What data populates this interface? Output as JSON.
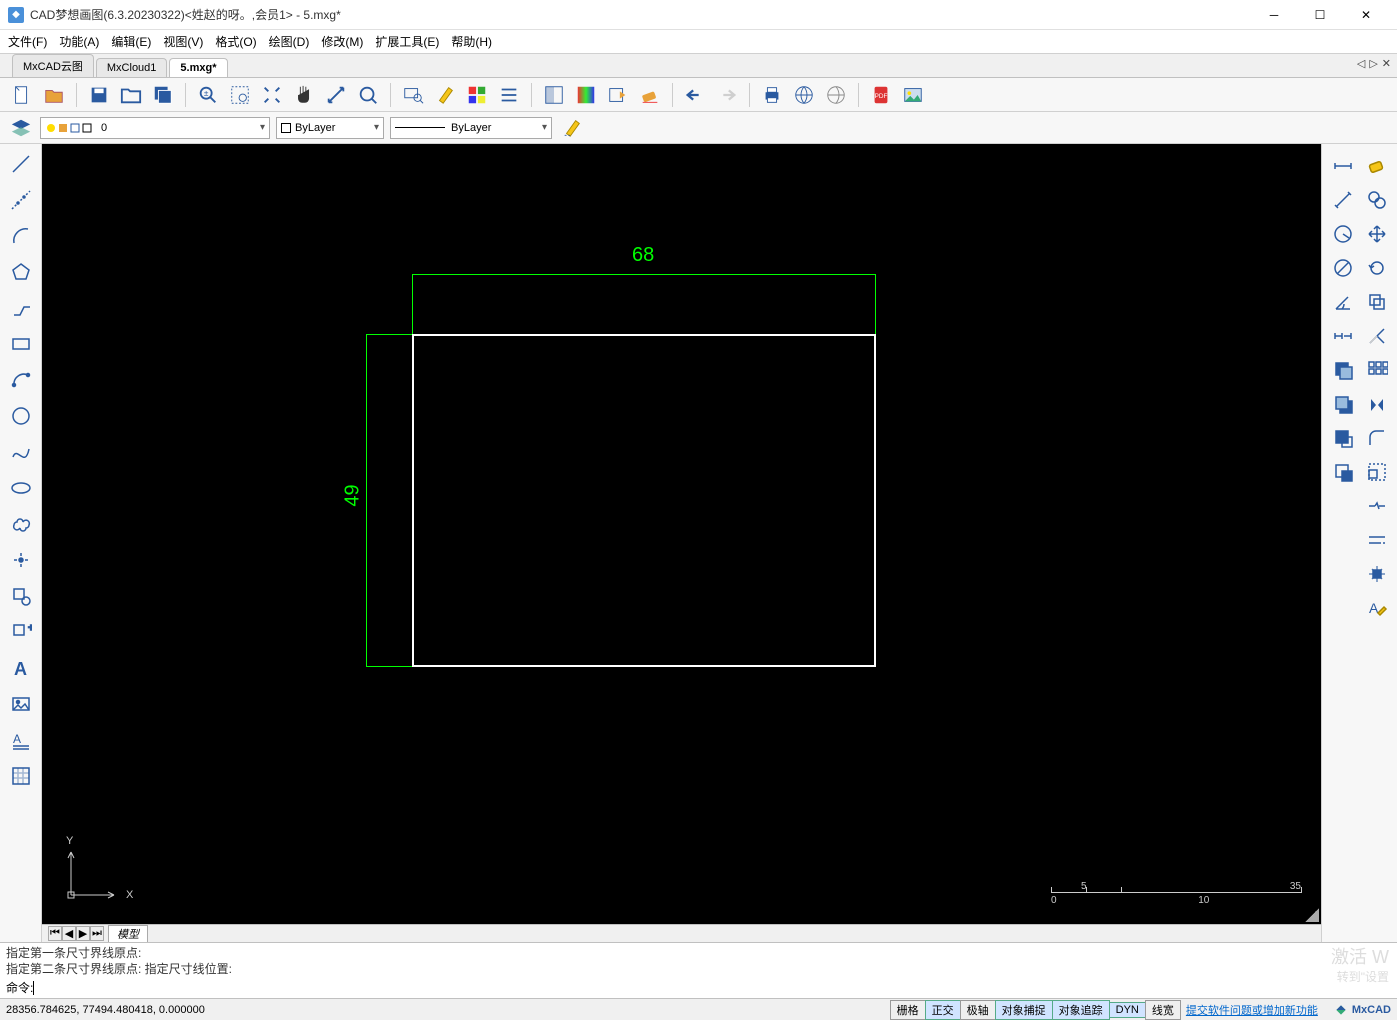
{
  "titlebar": {
    "title": "CAD梦想画图(6.3.20230322)<姓赵的呀。,会员1> - 5.mxg*"
  },
  "menu": {
    "file": "文件(F)",
    "func": "功能(A)",
    "edit": "编辑(E)",
    "view": "视图(V)",
    "format": "格式(O)",
    "draw": "绘图(D)",
    "modify": "修改(M)",
    "ext": "扩展工具(E)",
    "help": "帮助(H)"
  },
  "tabs": {
    "t1": "MxCAD云图",
    "t2": "MxCloud1",
    "t3": "5.mxg*"
  },
  "layerbar": {
    "layer_value": "0",
    "color_value": "ByLayer",
    "ltype_value": "ByLayer"
  },
  "drawing": {
    "dim_top": "68",
    "dim_left": "49",
    "ucs_y": "Y",
    "ucs_x": "X",
    "scale_0": "0",
    "scale_5": "5",
    "scale_10": "10",
    "scale_35": "35"
  },
  "model_tab": "模型",
  "cmd": {
    "hist1": "指定第一条尺寸界线原点:",
    "hist2": "指定第二条尺寸界线原点:   指定尺寸线位置:",
    "prompt": "命令: "
  },
  "watermark": {
    "l1": "激活 W",
    "l2": "转到\"设置"
  },
  "status": {
    "coords": "28356.784625,  77494.480418,  0.000000",
    "grid": "栅格",
    "ortho": "正交",
    "polar": "极轴",
    "osnap": "对象捕捉",
    "otrack": "对象追踪",
    "dyn": "DYN",
    "lwt": "线宽",
    "feedback": "提交软件问题或增加新功能",
    "brand": "MxCAD"
  }
}
